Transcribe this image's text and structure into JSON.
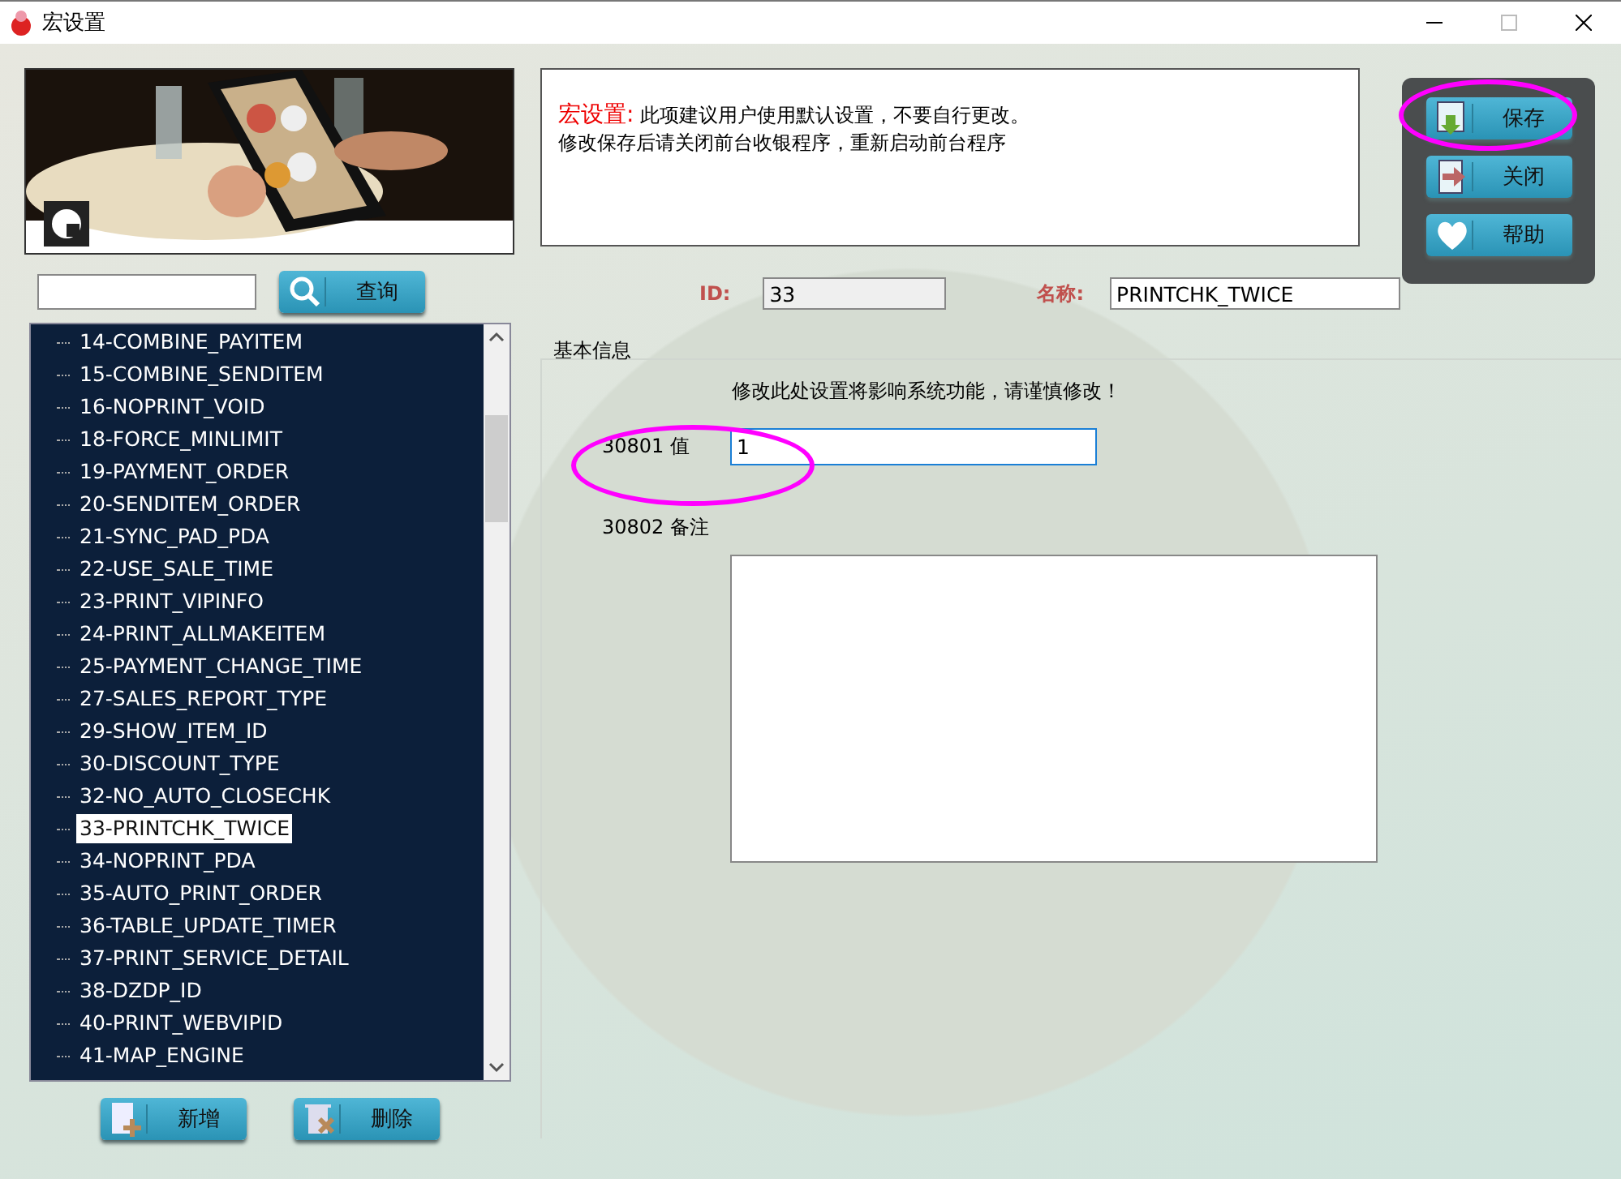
{
  "window": {
    "title": "宏设置"
  },
  "search": {
    "button": "查询"
  },
  "notice": {
    "heading": "宏设置:",
    "line1": "此项建议用户使用默认设置，不要自行更改。",
    "line2": "修改保存后请关闭前台收银程序，重新启动前台程序"
  },
  "actions": [
    "保存",
    "关闭",
    "帮助"
  ],
  "macro_list": [
    {
      "label": "14-COMBINE_PAYITEM",
      "selected": false
    },
    {
      "label": "15-COMBINE_SENDITEM",
      "selected": false
    },
    {
      "label": "16-NOPRINT_VOID",
      "selected": false
    },
    {
      "label": "18-FORCE_MINLIMIT",
      "selected": false
    },
    {
      "label": "19-PAYMENT_ORDER",
      "selected": false
    },
    {
      "label": "20-SENDITEM_ORDER",
      "selected": false
    },
    {
      "label": "21-SYNC_PAD_PDA",
      "selected": false
    },
    {
      "label": "22-USE_SALE_TIME",
      "selected": false
    },
    {
      "label": "23-PRINT_VIPINFO",
      "selected": false
    },
    {
      "label": "24-PRINT_ALLMAKEITEM",
      "selected": false
    },
    {
      "label": "25-PAYMENT_CHANGE_TIME",
      "selected": false
    },
    {
      "label": "27-SALES_REPORT_TYPE",
      "selected": false
    },
    {
      "label": "29-SHOW_ITEM_ID",
      "selected": false
    },
    {
      "label": "30-DISCOUNT_TYPE",
      "selected": false
    },
    {
      "label": "32-NO_AUTO_CLOSECHK",
      "selected": false
    },
    {
      "label": "33-PRINTCHK_TWICE",
      "selected": true
    },
    {
      "label": "34-NOPRINT_PDA",
      "selected": false
    },
    {
      "label": "35-AUTO_PRINT_ORDER",
      "selected": false
    },
    {
      "label": "36-TABLE_UPDATE_TIMER",
      "selected": false
    },
    {
      "label": "37-PRINT_SERVICE_DETAIL",
      "selected": false
    },
    {
      "label": "38-DZDP_ID",
      "selected": false
    },
    {
      "label": "40-PRINT_WEBVIPID",
      "selected": false
    },
    {
      "label": "41-MAP_ENGINE",
      "selected": false
    }
  ],
  "list_buttons": [
    "新增",
    "删除"
  ],
  "id": {
    "label": "ID:",
    "value": "33"
  },
  "name": {
    "label": "名称:",
    "value": "PRINTCHK_TWICE"
  },
  "basic_info": {
    "title": "基本信息",
    "warning": "修改此处设置将影响系统功能，请谨慎修改！",
    "value_field": {
      "label": "30801 值",
      "value": "1"
    },
    "remark_field": {
      "label": "30802 备注"
    }
  }
}
